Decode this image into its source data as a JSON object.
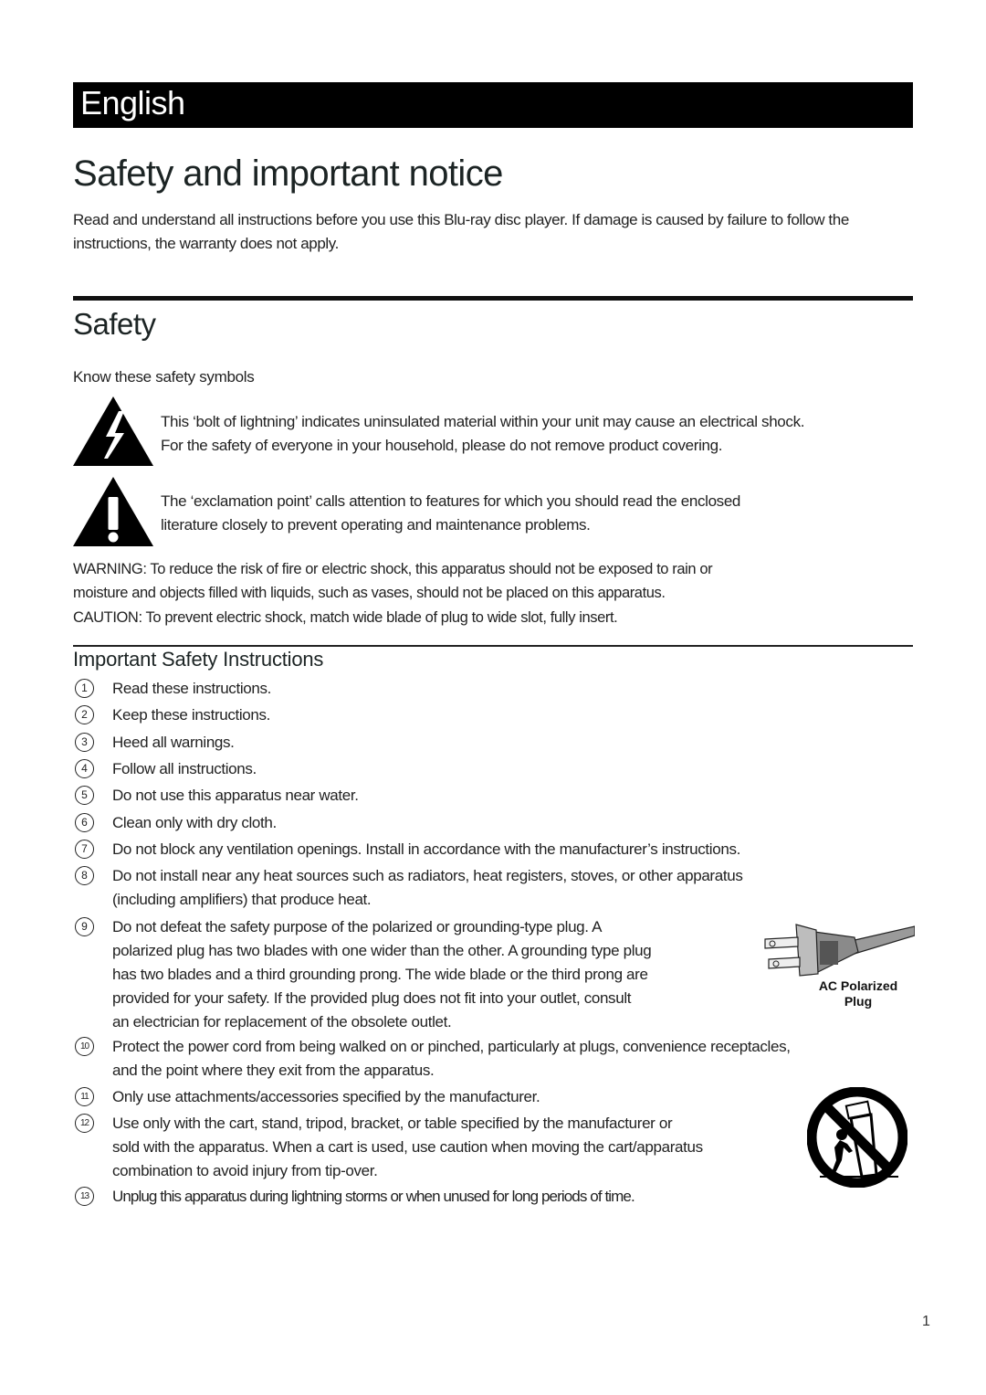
{
  "language_header": "English",
  "page_title": "Safety and important notice",
  "intro_text": "Read and understand all instructions before you use this Blu-ray disc player. If damage is caused by failure to follow the instructions, the warranty does not apply.",
  "safety": {
    "title": "Safety",
    "symbols_intro": "Know these safety symbols",
    "symbols": [
      {
        "icon": "lightning-warning-icon",
        "line1": "This ‘bolt of lightning’ indicates uninsulated material within your unit may cause an electrical shock.",
        "line2": "For the safety of everyone in your household, please do not remove product covering."
      },
      {
        "icon": "exclamation-warning-icon",
        "line1": "The ‘exclamation point’ calls attention to features for which you should read the enclosed",
        "line2": "literature closely to prevent operating and maintenance problems."
      }
    ],
    "warning": {
      "label": "WARNING:",
      "line1": " To reduce the risk of fire or electric shock, this apparatus should not be exposed to rain or",
      "line2": "moisture and objects filled with liquids, such as vases, should not be placed on this apparatus."
    },
    "caution": {
      "label": "CAUTION:",
      "text": " To prevent electric shock, match wide blade of plug to wide slot, fully insert."
    }
  },
  "instructions": {
    "title": "Important Safety Instructions",
    "items": [
      {
        "num": "1",
        "lines": [
          "Read these instructions."
        ]
      },
      {
        "num": "2",
        "lines": [
          "Keep these instructions."
        ]
      },
      {
        "num": "3",
        "lines": [
          "Heed all warnings."
        ]
      },
      {
        "num": "4",
        "lines": [
          "Follow all instructions."
        ]
      },
      {
        "num": "5",
        "lines": [
          "Do not use this apparatus near water."
        ]
      },
      {
        "num": "6",
        "lines": [
          "Clean only with dry cloth."
        ]
      },
      {
        "num": "7",
        "lines": [
          "Do not block any ventilation openings. Install in accordance with the manufacturer’s instructions."
        ]
      },
      {
        "num": "8",
        "lines": [
          "Do not install near any heat sources such as radiators, heat registers, stoves, or other apparatus",
          "(including amplifiers) that produce heat."
        ]
      },
      {
        "num": "9",
        "lines": [
          "Do not defeat the safety purpose of the polarized or grounding-type plug. A",
          "polarized plug has two blades with one wider than the other. A grounding type plug",
          "has two blades and a third grounding prong. The wide blade or the third prong are",
          "provided for your safety. If the provided plug does not fit into your outlet, consult",
          "an electrician for replacement of the obsolete outlet."
        ]
      },
      {
        "num": "10",
        "lines": [
          "Protect the power cord from being walked on or pinched, particularly at plugs, convenience receptacles,",
          "and the point where they exit from the apparatus."
        ]
      },
      {
        "num": "11",
        "lines": [
          "Only use attachments/accessories specified by the manufacturer."
        ]
      },
      {
        "num": "12",
        "lines": [
          "Use only with the cart, stand, tripod, bracket, or table specified by the manufacturer or",
          "sold with the apparatus. When a cart is used, use caution when moving the cart/apparatus",
          "combination to avoid injury from tip-over."
        ]
      },
      {
        "num": "13",
        "lines": [
          "Unplug this apparatus during lightning storms or when unused for long periods of time."
        ]
      }
    ],
    "plug_figure": {
      "icon": "ac-polarized-plug-icon",
      "label_line1": "AC Polarized",
      "label_line2": "Plug"
    },
    "cart_figure": {
      "icon": "cart-tip-over-warning-icon"
    }
  },
  "page_number": "1"
}
